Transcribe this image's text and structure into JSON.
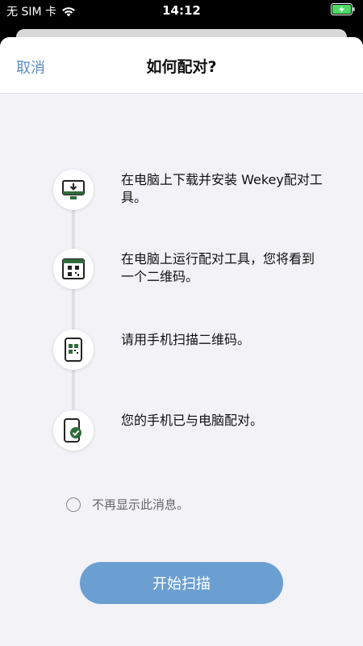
{
  "status_bar": {
    "carrier": "无 SIM 卡",
    "time": "14:12"
  },
  "nav": {
    "cancel_label": "取消",
    "title": "如何配对?"
  },
  "steps": [
    {
      "icon": "download-monitor-icon",
      "text": "在电脑上下载并安装 Wekey配对工具。"
    },
    {
      "icon": "qr-window-icon",
      "text": "在电脑上运行配对工具，您将看到一个二维码。"
    },
    {
      "icon": "phone-qr-icon",
      "text": "请用手机扫描二维码。"
    },
    {
      "icon": "phone-check-icon",
      "text": "您的手机已与电脑配对。"
    }
  ],
  "dont_show_label": "不再显示此消息。",
  "start_button_label": "开始扫描",
  "colors": {
    "accent": "#5a8dbf",
    "button": "#6b9fd1",
    "icon_green": "#2f6b3a"
  }
}
